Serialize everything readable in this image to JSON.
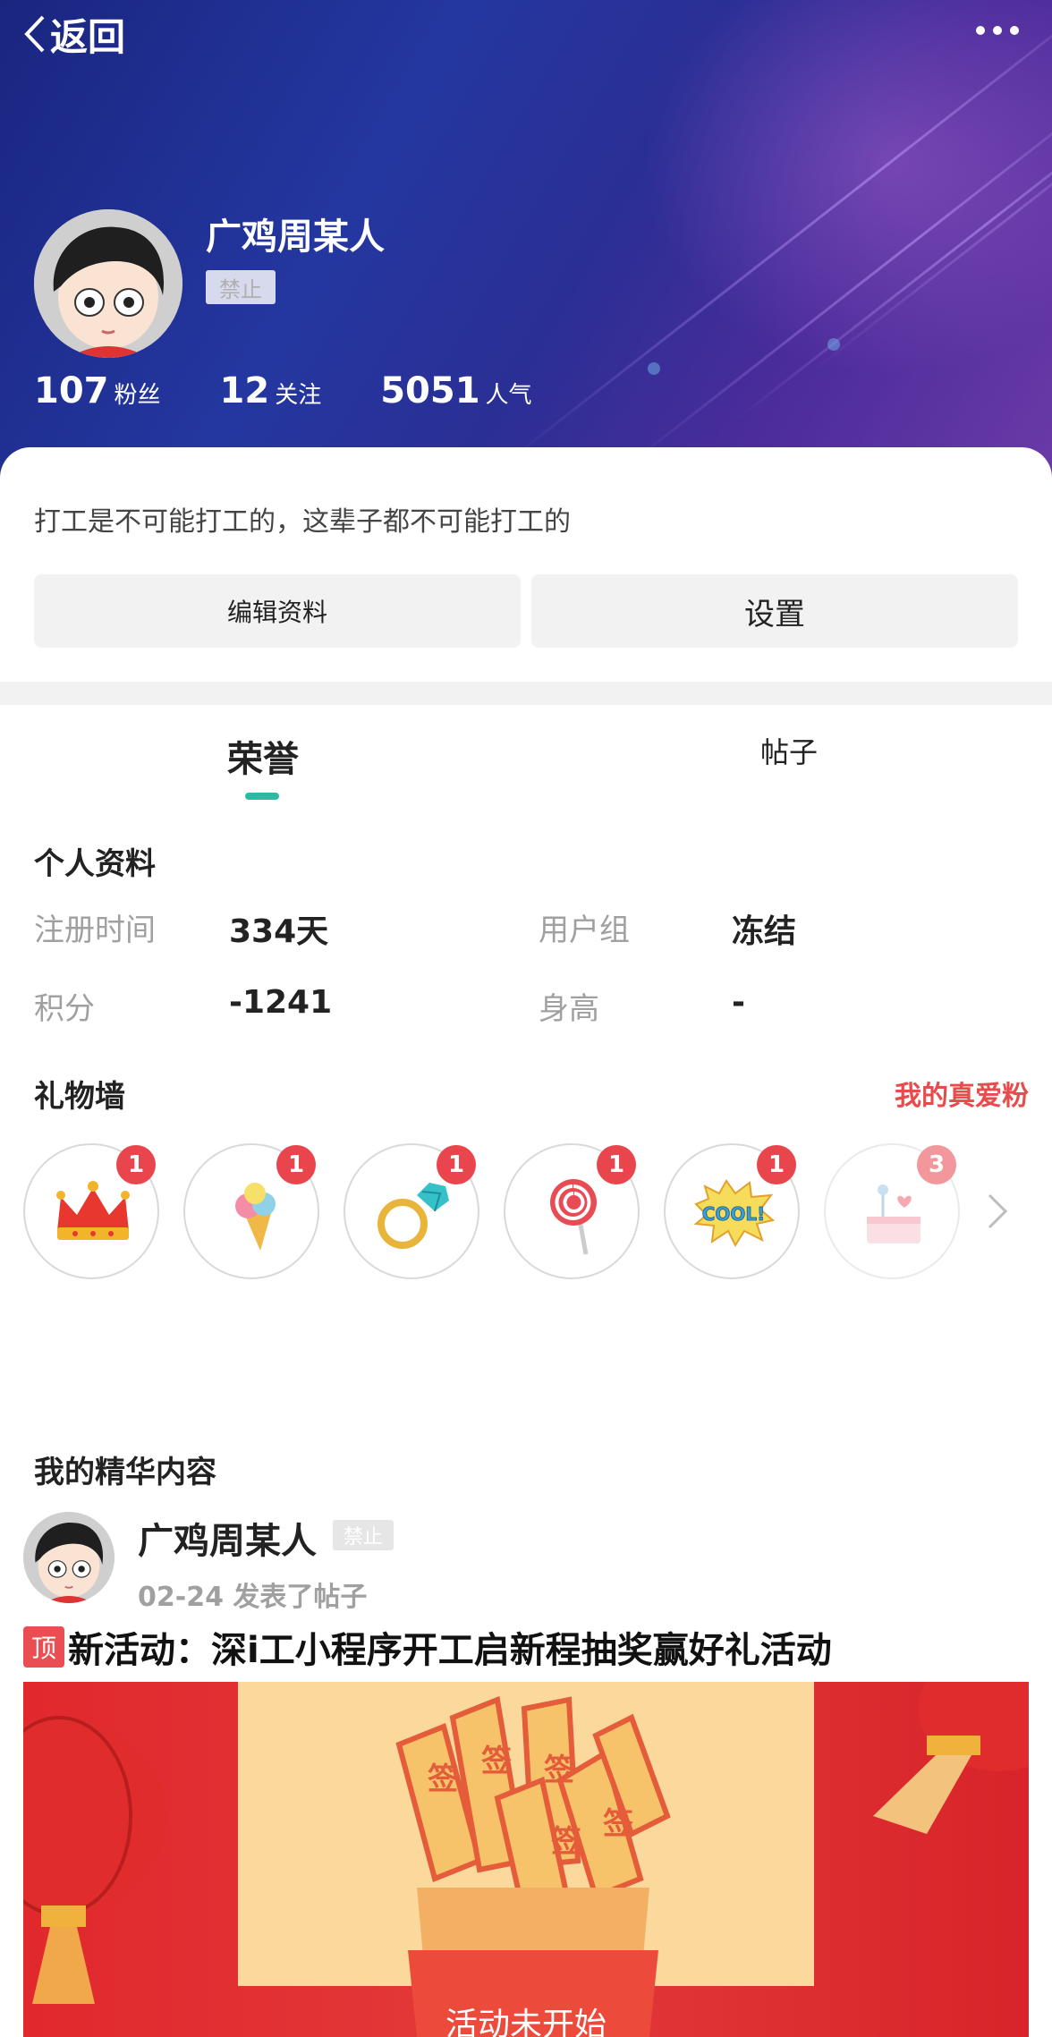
{
  "nav": {
    "back_label": "返回"
  },
  "profile": {
    "username": "广鸡周某人",
    "status_badge": "禁止",
    "stats": [
      {
        "value": "107",
        "label": "粉丝"
      },
      {
        "value": "12",
        "label": "关注"
      },
      {
        "value": "5051",
        "label": "人气"
      }
    ],
    "bio": "打工是不可能打工的，这辈子都不可能打工的",
    "edit_button": "编辑资料",
    "settings_button": "设置"
  },
  "tabs": [
    {
      "label": "荣誉",
      "active": true
    },
    {
      "label": "帖子",
      "active": false
    }
  ],
  "info": {
    "title": "个人资料",
    "fields": [
      {
        "label": "注册时间",
        "value": "334天"
      },
      {
        "label": "用户组",
        "value": "冻结"
      },
      {
        "label": "积分",
        "value": "-1241"
      },
      {
        "label": "身高",
        "value": "-"
      }
    ]
  },
  "gifts": {
    "title": "礼物墙",
    "link": "我的真爱粉",
    "items": [
      {
        "icon": "crown-icon",
        "count": "1"
      },
      {
        "icon": "ice-cream-icon",
        "count": "1"
      },
      {
        "icon": "diamond-ring-icon",
        "count": "1",
        "note": ""
      },
      {
        "icon": "lollipop-icon",
        "count": "1"
      },
      {
        "icon": "cool-sticker-icon",
        "count": "1"
      },
      {
        "icon": "cake-icon",
        "count": "3"
      }
    ]
  },
  "featured": {
    "title": "我的精华内容",
    "author": "广鸡周某人",
    "author_badge": "禁止",
    "meta": "02-24 发表了帖子",
    "pin_label": "顶",
    "post_title": "新活动：深i工小程序开工启新程抽奖赢好礼活动",
    "banner_text": "活动未开始"
  },
  "colors": {
    "accent": "#2fb9a3",
    "link": "#e84b4b",
    "badge": "#e9454d"
  }
}
